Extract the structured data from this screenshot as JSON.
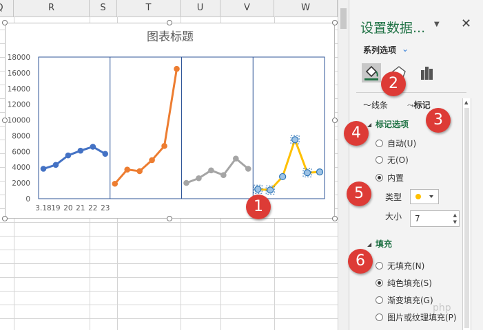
{
  "sheet": {
    "columns": [
      "Q",
      "R",
      "S",
      "T",
      "U",
      "V",
      "W"
    ]
  },
  "chart_data": {
    "type": "line",
    "title": "图表标题",
    "yticks": [
      "18000",
      "16000",
      "14000",
      "12000",
      "10000",
      "8000",
      "6000",
      "4000",
      "2000",
      "0"
    ],
    "ylim": [
      0,
      18000
    ],
    "xticks": [
      "3.18",
      "19",
      "20",
      "21",
      "22",
      "23"
    ],
    "panels": 4,
    "series": [
      {
        "color": "#4472c4",
        "values": [
          3800,
          4300,
          5500,
          6100,
          6600,
          5700
        ]
      },
      {
        "color": "#ed7d31",
        "values": [
          1900,
          3700,
          3500,
          4900,
          6700,
          16500
        ]
      },
      {
        "color": "#a5a5a5",
        "values": [
          2000,
          2600,
          3600,
          3000,
          5100,
          3800
        ]
      },
      {
        "color": "#ffc000",
        "values": [
          1200,
          1100,
          2800,
          7500,
          3300,
          3400
        ]
      }
    ]
  },
  "pane": {
    "title": "设置数据...",
    "series_options": "系列选项",
    "tab_line": "线条",
    "tab_marker": "标记",
    "marker_section": "标记选项",
    "radio_auto": "自动(U)",
    "radio_none": "无(O)",
    "radio_builtin": "内置",
    "type_label": "类型",
    "size_label": "大小",
    "size_value": "7",
    "marker_color": "#ffc000",
    "fill_section": "填充",
    "fill_none": "无填充(N)",
    "fill_solid": "纯色填充(S)",
    "fill_gradient": "渐变填充(G)",
    "fill_picture": "图片或纹理填充(P)"
  },
  "callouts": [
    "1",
    "2",
    "3",
    "4",
    "5",
    "6"
  ],
  "watermark": "php",
  "colors": {
    "accent": "#217346",
    "callout": "#dd3b36"
  }
}
